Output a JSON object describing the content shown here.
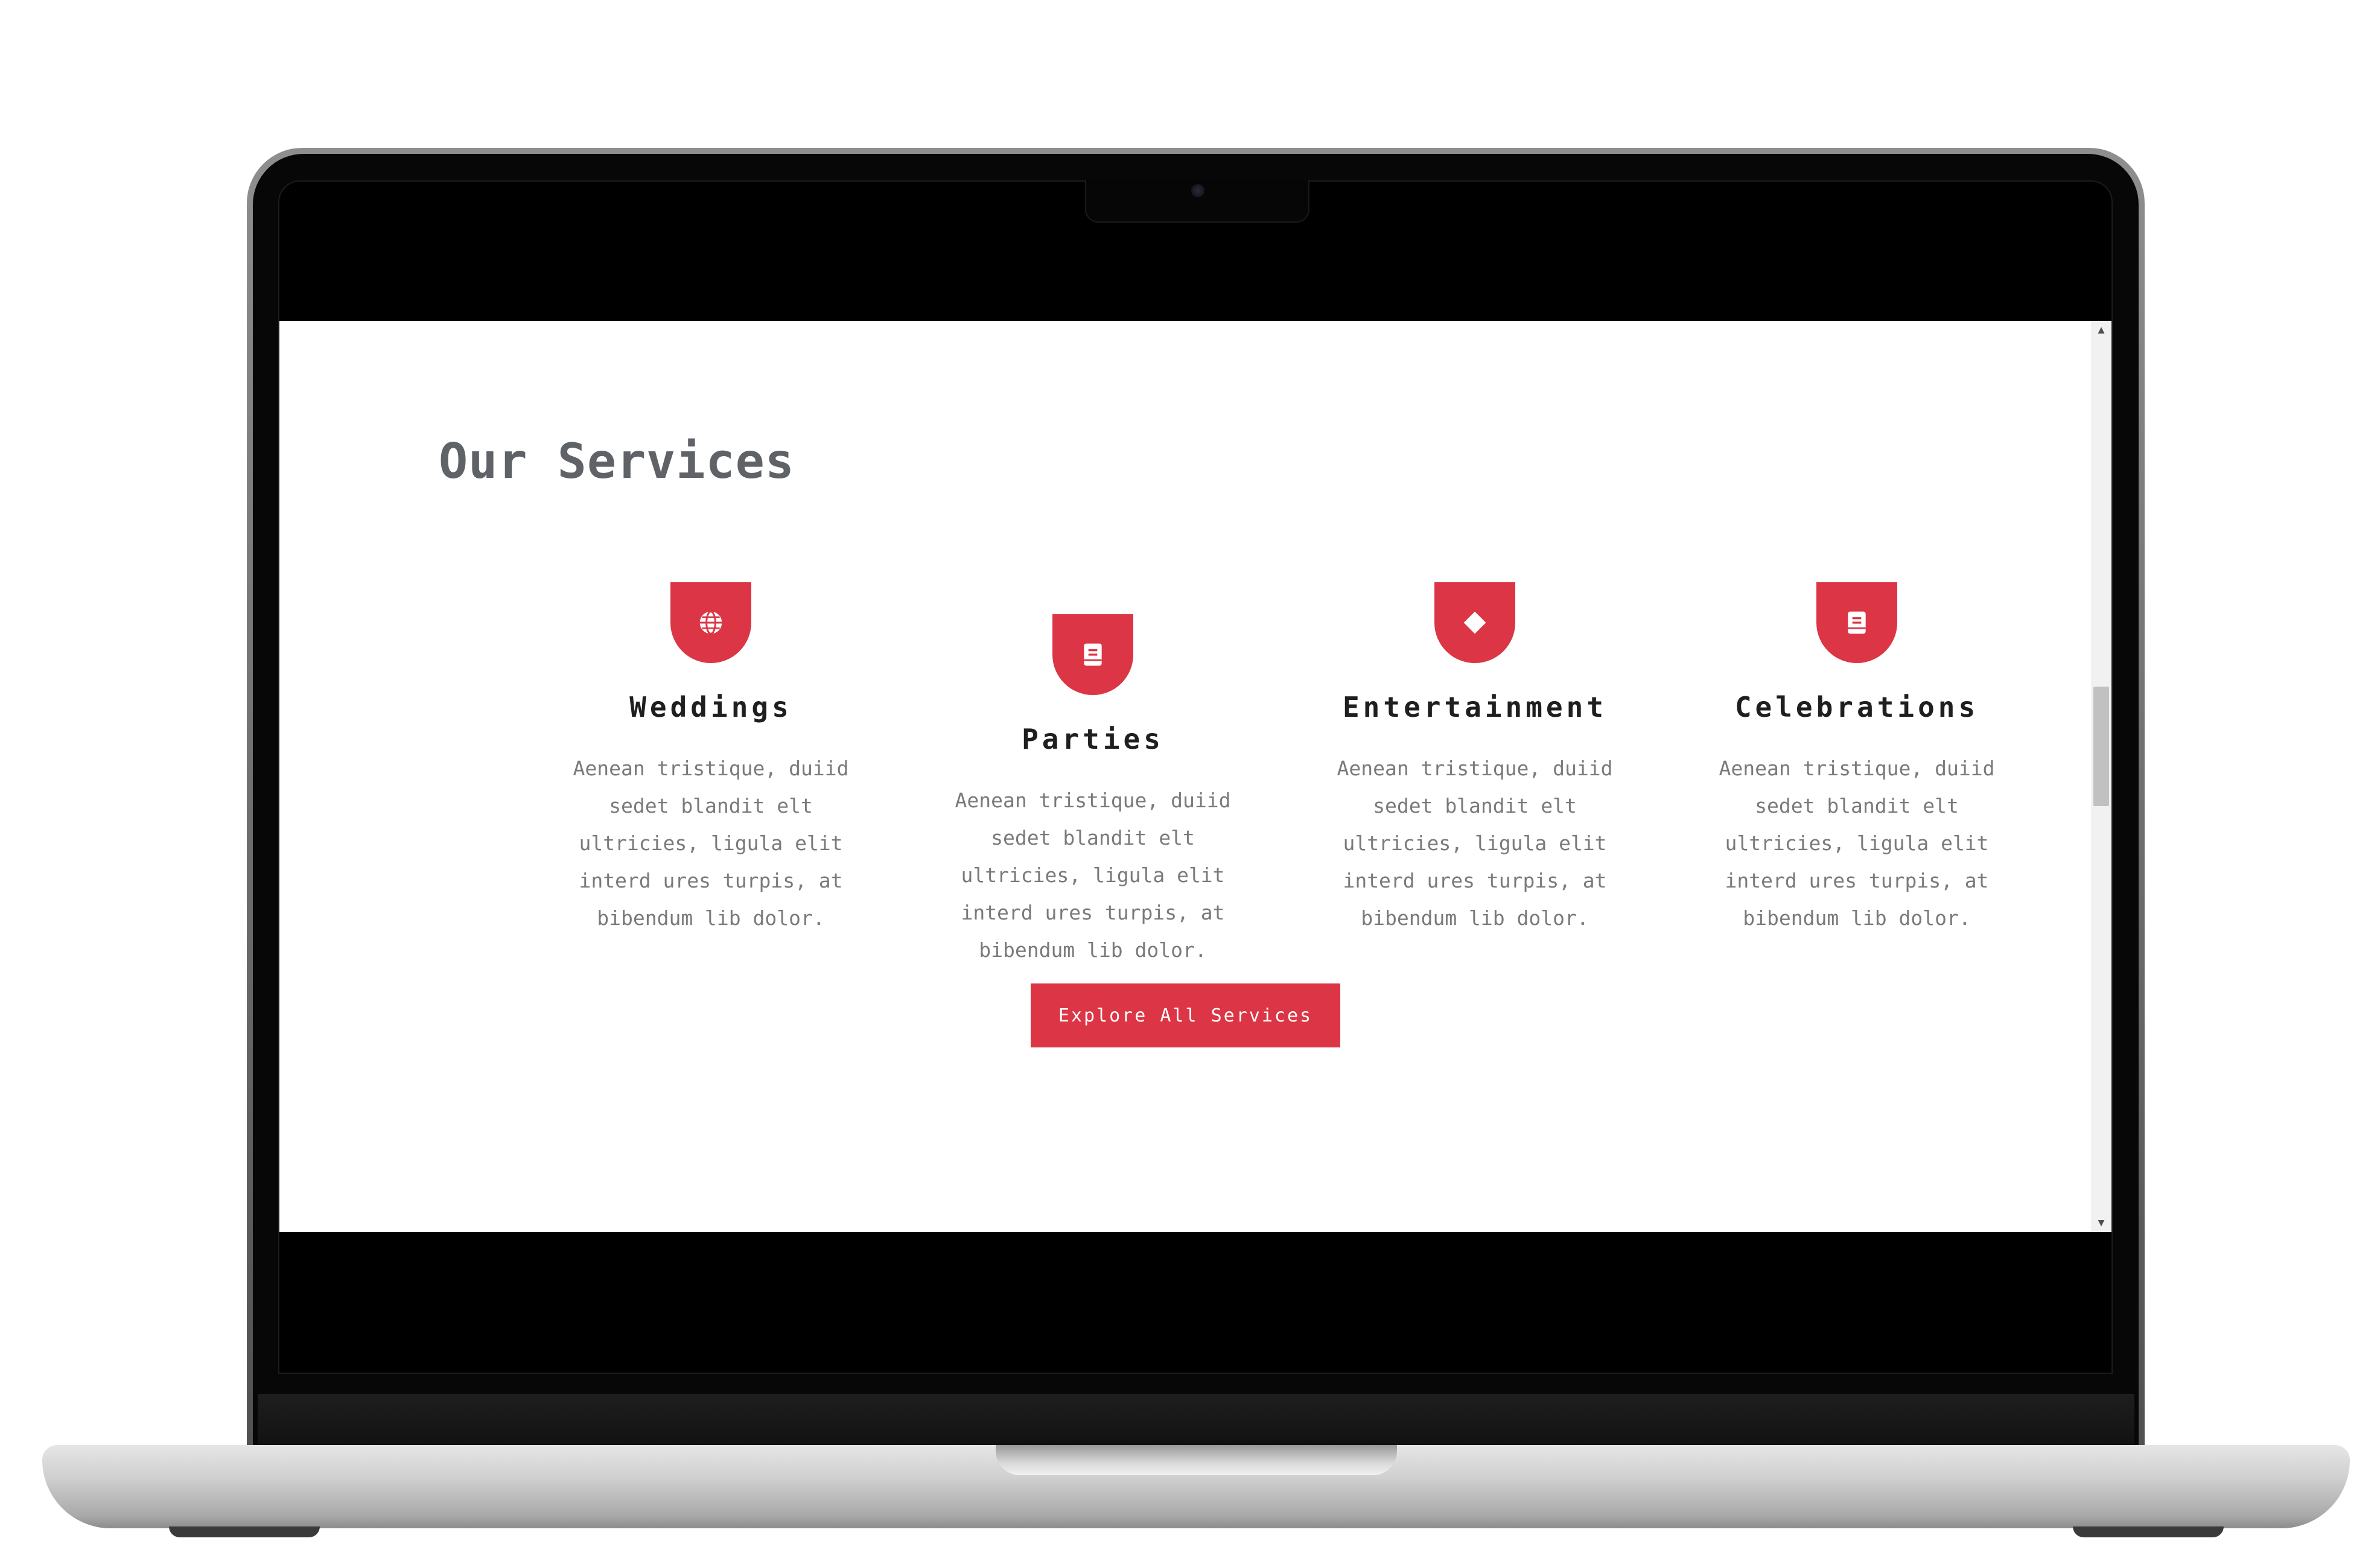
{
  "colors": {
    "accent": "#dc3545",
    "heading": "#5f6368",
    "card_title": "#1f1f1f",
    "body_text": "#7a7a7a"
  },
  "page": {
    "section_title": "Our Services"
  },
  "services": [
    {
      "icon": "globe-icon",
      "title": "Weddings",
      "description": "Aenean tristique, duiid sedet blandit elt ultricies, ligula elit interd ures turpis, at bibendum lib dolor."
    },
    {
      "icon": "book-icon",
      "title": "Parties",
      "description": "Aenean tristique, duiid sedet blandit elt ultricies, ligula elit interd ures turpis, at bibendum lib dolor."
    },
    {
      "icon": "diamond-icon",
      "title": "Entertainment",
      "description": "Aenean tristique, duiid sedet blandit elt ultricies, ligula elit interd ures turpis, at bibendum lib dolor."
    },
    {
      "icon": "book-icon",
      "title": "Celebrations",
      "description": "Aenean tristique, duiid sedet blandit elt ultricies, ligula elit interd ures turpis, at bibendum lib dolor."
    }
  ],
  "cta": {
    "label": "Explore All Services"
  }
}
